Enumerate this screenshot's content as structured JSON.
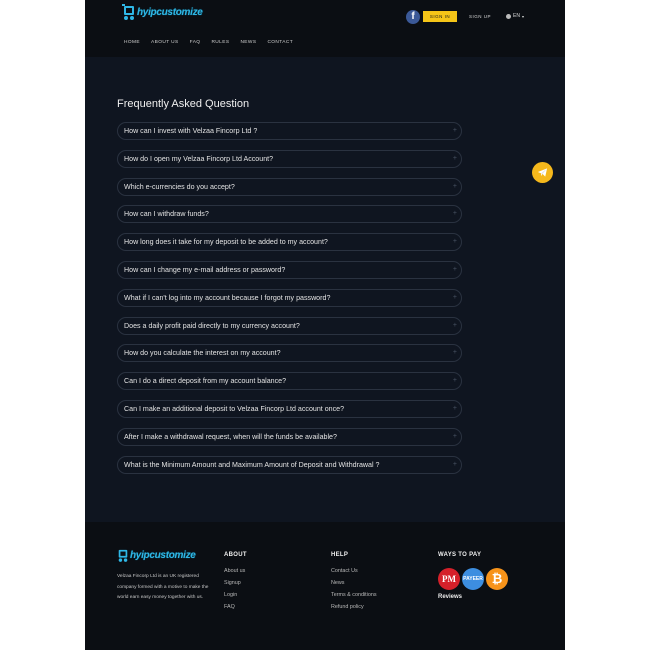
{
  "header": {
    "logo_text": "hyipcustomize",
    "fb_label": "f",
    "signin_label": "SIGN IN",
    "signup_label": "SIGN UP",
    "lang_label": "EN",
    "nav": [
      "HOME",
      "ABOUT US",
      "FAQ",
      "RULES",
      "NEWS",
      "CONTACT"
    ]
  },
  "faq": {
    "title": "Frequently Asked Question",
    "plus": "+",
    "questions": [
      "How can I invest with Velzaa Fincorp Ltd ?",
      "How do I open my Velzaa Fincorp Ltd Account?",
      "Which e-currencies do you accept?",
      "How can I withdraw funds?",
      "How long does it take for my deposit to be added to my account?",
      "How can I change my e-mail address or password?",
      "What if I can't log into my account because I forgot my password?",
      "Does a daily profit paid directly to my currency account?",
      "How do you calculate the interest on my account?",
      "Can I do a direct deposit from my account balance?",
      "Can I make an additional deposit to Velzaa Fincorp Ltd account once?",
      "After I make a withdrawal request, when will the funds be available?",
      "What is the Minimum Amount and Maximum Amount of Deposit and Withdrawal ?"
    ]
  },
  "footer": {
    "logo_text": "hyipcustomize",
    "about_text": "Velzaa Fincorp Ltd is an UK registered company formed with a motive to make the world earn easy money together with us.",
    "about": {
      "title": "ABOUT",
      "links": [
        "About us",
        "Signup",
        "Login",
        "FAQ"
      ]
    },
    "help": {
      "title": "HELP",
      "links": [
        "Contact Us",
        "News",
        "Terms & conditions",
        "Refund policy"
      ]
    },
    "pay": {
      "title": "WAYS TO PAY",
      "pm": "PM",
      "payeer": "PAYEER",
      "btc": "₿",
      "reviews": "Reviews"
    }
  },
  "colors": {
    "accent": "#f5c518",
    "background": "#0f1520",
    "header": "#0b0e13"
  }
}
